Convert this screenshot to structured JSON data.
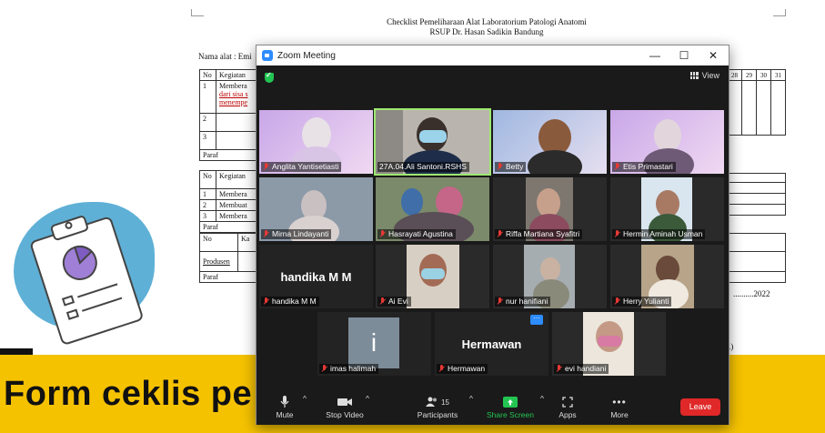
{
  "document": {
    "title_line1": "Checklist Pemeliharaan Alat Laboratorium Patologi Anatomi",
    "title_line2": "RSUP Dr. Hasan Sadikin Bandung",
    "name_label": "Nama alat : Emi",
    "table1": {
      "col_no": "No",
      "col_kegiatan": "Kegiatan",
      "rows": [
        "1",
        "2",
        "3"
      ],
      "row1_text_a": "Membera",
      "row1_text_b": "dari sisa s",
      "row1_text_c": "menempe",
      "footer": "Paraf"
    },
    "table2": {
      "col_no": "No",
      "col_kegiatan": "Kegiatan",
      "rows": [
        [
          "1",
          "Membera"
        ],
        [
          "2",
          "Membuat"
        ],
        [
          "3",
          "Membera"
        ]
      ],
      "footer": "Paraf"
    },
    "table3": {
      "col_no": "No",
      "col_ka": "Ka",
      "produsen": "Produsen",
      "footer": "Paraf"
    },
    "right_days": [
      "28",
      "29",
      "30",
      "31"
    ],
    "date_text": "..........2022",
    "paren_text": ".)"
  },
  "banner": {
    "text": "Form ceklis pe"
  },
  "zoom": {
    "window_title": "Zoom Meeting",
    "controls": {
      "minimize": "—",
      "maximize": "☐",
      "close": "✕"
    },
    "view_label": "View",
    "participants": [
      {
        "name": "Anglita Yantisetiasti",
        "muted": true
      },
      {
        "name": "27A.04.Ali Santoni.RSHS",
        "muted": false,
        "active": true
      },
      {
        "name": "Betty",
        "muted": true
      },
      {
        "name": "Etis Primastari",
        "muted": true
      },
      {
        "name": "Mirna Lindayanti",
        "muted": true
      },
      {
        "name": "Hasrayati Agustina",
        "muted": true
      },
      {
        "name": "Riffa Martiana Syafitri",
        "muted": true
      },
      {
        "name": "Hermin Aminah Usman",
        "muted": true
      },
      {
        "name": "handika M M",
        "muted": true,
        "big_name": "handika M M"
      },
      {
        "name": "Ai Evi",
        "muted": true
      },
      {
        "name": "nur hanifiani",
        "muted": true
      },
      {
        "name": "Herry Yulianti",
        "muted": true
      },
      {
        "name": "imas halimah",
        "muted": true,
        "avatar_letter": "i"
      },
      {
        "name": "Hermawan",
        "muted": true,
        "big_name": "Hermawan"
      },
      {
        "name": "evi handiani",
        "muted": true
      }
    ],
    "toolbar": {
      "mute": "Mute",
      "stop_video": "Stop Video",
      "participants": "Participants",
      "participants_count": "15",
      "share_screen": "Share Screen",
      "apps": "Apps",
      "more": "More",
      "leave": "Leave"
    }
  },
  "colors": {
    "zoom_bg": "#1a1a1a",
    "banner": "#f5c200",
    "leave": "#e02828",
    "active_speaker": "#9fe870",
    "share_green": "#23c552"
  }
}
